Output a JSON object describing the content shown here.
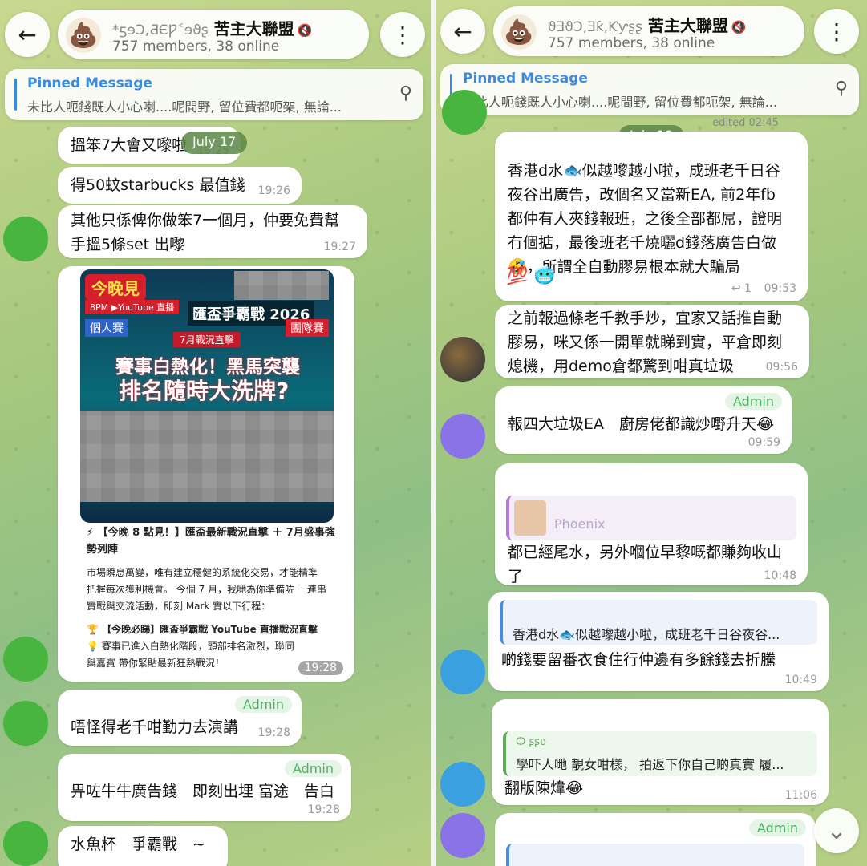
{
  "group": {
    "emoji": "💩",
    "name": "苦主大聯盟",
    "name_prefix_left": "*ƽɘƆ,ƋЄǷ˂ɘϑʂ",
    "name_prefix_right": "ϑƎϑƆ,Ǝƙ,Ƙƴʂʂ",
    "mute_icon": "🔇",
    "subtitle_left": "757 members, 38 online",
    "subtitle_right": "757 members, 38 online"
  },
  "pinned": {
    "title": "Pinned Message",
    "text": "未比人呃錢既人小心喇....呢間野, 留位費都呃架, 無論..."
  },
  "icons": {
    "back": "←",
    "more": "⋮",
    "pin": "⚲",
    "scroll_down": "⌄"
  },
  "left_chat": {
    "date": "July 17",
    "messages": [
      {
        "text": "搵笨7大會又嚟啦",
        "time": "19:25"
      },
      {
        "text": "得50蚊starbucks 最值錢",
        "time": "19:26"
      },
      {
        "text_line1": "其他只係俾你做笨7一個月，仲要免費幫",
        "text_line2": "手搵5條set 出嚟",
        "time": "19:27"
      },
      {
        "poster": {
          "tag": "今晚見",
          "live": "8PM ▶YouTube 直播",
          "event": "匯盃爭霸戰 2026",
          "sub": "7月戰況直擊",
          "headline1": "賽事白熱化！黑馬突襲",
          "headline2": "排名隨時大洗牌?",
          "left_badge": "個人賽",
          "right_badge": "團隊賽"
        },
        "caption_title": "⚡ 【今晚 8 點見！】匯盃最新戰況直擊 ＋ 7月盛事強勢列陣",
        "caption_body1": "市場瞬息萬變，唯有建立穩健的系統化交易，才能精準",
        "caption_body2": "把握每次獲利機會。 今個 7 月，我哋為你準備咗 一連串",
        "caption_body3": "實戰與交流活動，即刻 Mark 實以下行程：",
        "caption_line4": "🏆 【今晚必睇】匯盃爭霸戰 YouTube 直播戰況直擊",
        "caption_line5": "💡 賽事已進入白熱化階段，頭部排名激烈，聯同",
        "caption_line6": "與嘉賓 帶你緊貼最新狂熱戰況！",
        "time": "19:28"
      },
      {
        "admin": "Admin",
        "text": "唔怪得老千咁勤力去演講",
        "time": "19:28"
      },
      {
        "admin": "Admin",
        "text": "畀咗牛牛廣告錢　即刻出埋 富途　告白",
        "time": "19:28"
      },
      {
        "text": "水魚杯　爭霸戰　~"
      }
    ]
  },
  "right_chat": {
    "date": "July 19",
    "edited": "edited 02:45",
    "messages": [
      {
        "line1": "香港d水🐟似越嚟越小啦，成班老千日谷",
        "line2": "夜谷出廣告，改個名又當新EA, 前2年fb",
        "line3": "都仲有人夾錢報班，之後全部都屌，證明",
        "line4": "冇個掂，最後班老千燒曬d錢落廣告白做",
        "line5": "🤣，所謂全自動膠易根本就大騙局",
        "reactions": "💯 🥶",
        "replies": "↩ 1",
        "time": "09:53"
      },
      {
        "line1": "之前報過條老千教手炒，宜家又話推自動",
        "line2": "膠易，咪又係一開單就睇到實，平倉即刻",
        "line3": "熄機，用demo倉都驚到咁真垃圾",
        "time": "09:56"
      },
      {
        "admin": "Admin",
        "text": "報四大垃圾EA　廚房佬都識炒嘢升天😂",
        "time": "09:59"
      },
      {
        "reply_name": "Phoenix",
        "line1": "都已經尾水，另外嗰位早黎嘅都賺夠收山",
        "line2": "了",
        "time": "10:48"
      },
      {
        "reply_text": "香港d水🐟似越嚟越小啦，成班老千日谷夜谷...",
        "text": "啲錢要留番衣食住行仲邊有多餘錢去折騰",
        "time": "10:49"
      },
      {
        "reply_name": "Ѻ ʂʂʋ",
        "reply_text": "學吓人哋 靚女咁樣， 拍返下你自己啲真實 履...",
        "text": "翻版陳煒😂",
        "time": "11:06"
      },
      {
        "admin": "Admin"
      }
    ]
  }
}
